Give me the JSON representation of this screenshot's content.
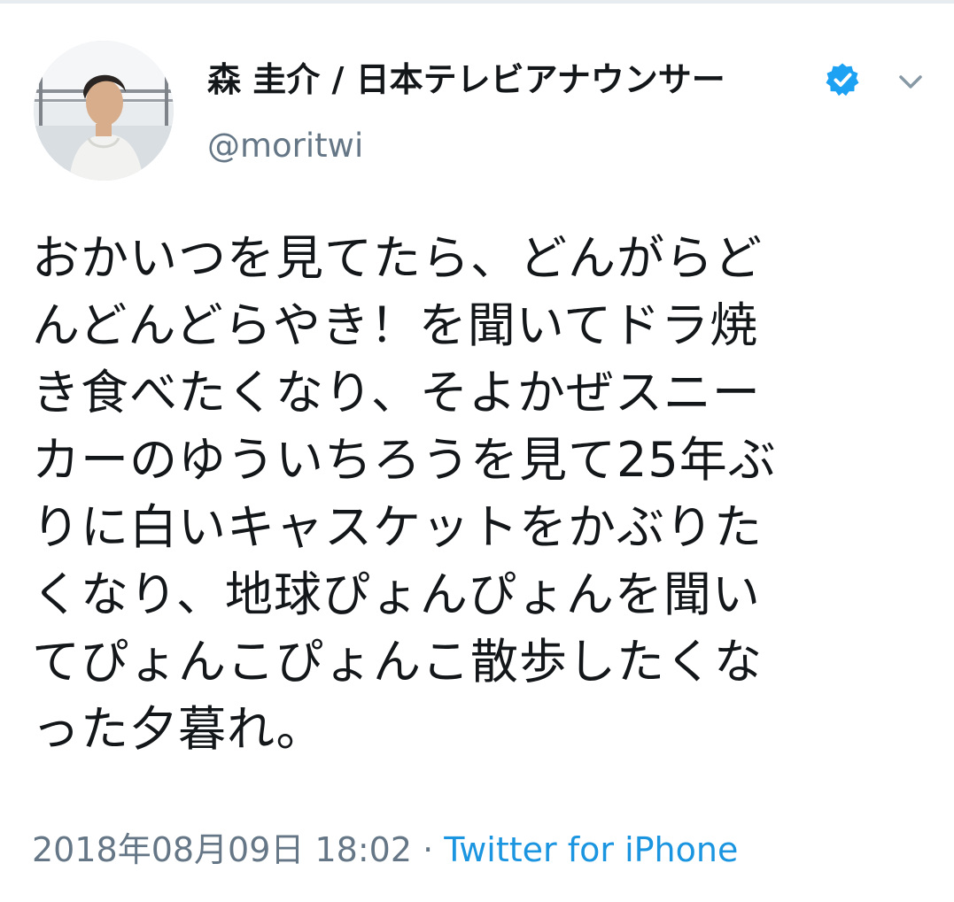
{
  "tweet": {
    "author": {
      "display_name": "森 圭介 / 日本テレビアナウンサー",
      "handle": "@moritwi",
      "verified": true,
      "avatar": "profile-photo"
    },
    "text_lines": [
      "おかいつを見てたら、どんがらど",
      "んどんどらやき！を聞いてドラ焼",
      "き食べたくなり、そよかぜスニー",
      "カーのゆういちろうを見て25年ぶ",
      "りに白いキャスケットをかぶりた",
      "くなり、地球ぴょんぴょんを聞い",
      "てぴょんこぴょんこ散歩したくな",
      "った夕暮れ。"
    ],
    "timestamp": "2018年08月09日 18:02",
    "separator": "·",
    "source": "Twitter for iPhone",
    "colors": {
      "text": "#14171a",
      "muted": "#657786",
      "link": "#1b95e0",
      "verified": "#1da1f2"
    },
    "icons": {
      "verified": "verified-badge-icon",
      "more": "chevron-down-icon"
    }
  }
}
